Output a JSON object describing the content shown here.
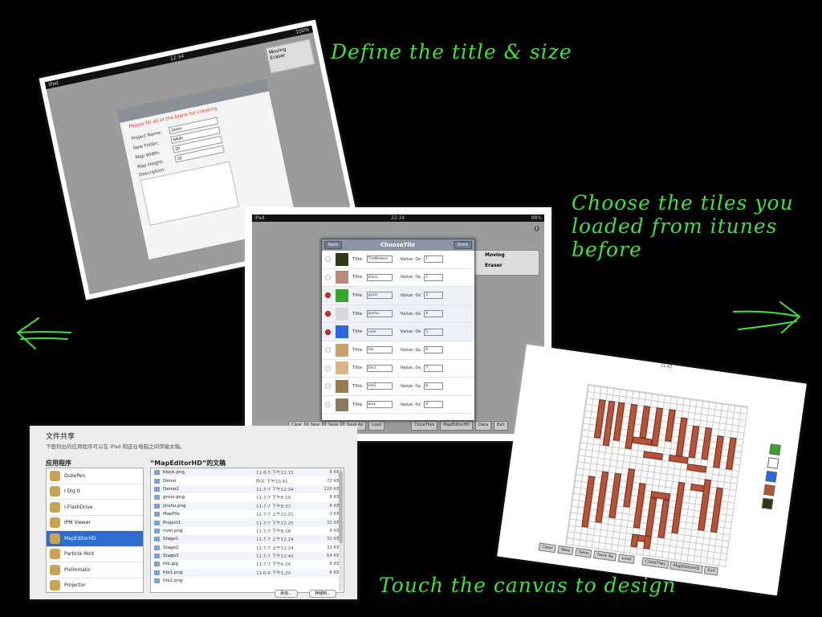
{
  "captions": {
    "define": "Define the title & size",
    "choose": "Choose the tiles you loaded from itunes before",
    "touch": "Touch the canvas to design"
  },
  "colors": {
    "accent": "#3fe13b",
    "background": "#000000"
  },
  "icons": {
    "left_arrow": "arrow-left-icon",
    "right_arrow": "arrow-right-icon"
  },
  "shot1": {
    "status_time": "12:34",
    "warning": "Please fill all of the blank for creating",
    "fields": [
      {
        "label": "Project Name:",
        "value": "Demo"
      },
      {
        "label": "New Folder:",
        "value": "Mkdir"
      },
      {
        "label": "Map Width:",
        "value": "20"
      },
      {
        "label": "Map Height:",
        "value": "32"
      }
    ],
    "description_label": "Description:",
    "side_moving": "Moving",
    "side_eraser": "Eraser"
  },
  "shot2": {
    "status_left": "iPad",
    "status_time": "22:34",
    "status_right": "98%",
    "title": "ChooseTile",
    "back_button": "Back",
    "done_button": "Done",
    "title_label": "Title:",
    "value_label": "Value: 0x",
    "tiles": [
      {
        "title": "TileModern",
        "value": "1",
        "selected": false,
        "color": "#2d3a12"
      },
      {
        "title": "block",
        "value": "2",
        "selected": false,
        "color": "#b98a7b"
      },
      {
        "title": "gross",
        "value": "3",
        "selected": true,
        "color": "#37a52a"
      },
      {
        "title": "jinshu",
        "value": "4",
        "selected": true,
        "color": "#d8d8d8"
      },
      {
        "title": "river",
        "value": "5",
        "selected": true,
        "color": "#2c66e3"
      },
      {
        "title": "tile",
        "value": "6",
        "selected": false,
        "color": "#c9a06c"
      },
      {
        "title": "tile1",
        "value": "7",
        "selected": false,
        "color": "#ddb486"
      },
      {
        "title": "tile2",
        "value": "8",
        "selected": false,
        "color": "#9c7a55"
      },
      {
        "title": "way",
        "value": "9",
        "selected": false,
        "color": "#8e7b5e"
      }
    ],
    "side_moving": "Moving",
    "side_eraser": "Eraser",
    "bottom_buttons": [
      "Clear",
      "New",
      "Save",
      "Save As",
      "Load",
      "CloseTiles",
      "MapEditorHD",
      "Data",
      "Exit"
    ]
  },
  "shot3": {
    "title": "文件共享",
    "subtitle": "下面列出的应用程序可以在 iPad 和这台电脑之间传输文稿。",
    "apps_header": "应用程序",
    "docs_header": "“MapEditorHD”的文稿",
    "apps": [
      "DukePen",
      "I Dig It",
      "i-FlashDrive",
      "IPM Viewer",
      "MapEditorHD",
      "Particle Mint",
      "Pixlromatic",
      "Projector",
      "QR HD"
    ],
    "selected_app": "MapEditorHD",
    "docs": [
      {
        "name": "block.png",
        "date": "11-6-5 下午12:15",
        "size": "8 KB"
      },
      {
        "name": "Demo",
        "date": "昨天 下午10:41",
        "size": "72 KB"
      },
      {
        "name": "Demo2",
        "date": "11-7-7 下午12:34",
        "size": "120 KB"
      },
      {
        "name": "gross.png",
        "date": "11-7-7 下午8:19",
        "size": "8 KB"
      },
      {
        "name": "jinshu.png",
        "date": "11-7-7 下午8:33",
        "size": "8 KB"
      },
      {
        "name": "MapFile",
        "date": "11-7-7 上午12:21",
        "size": "0 KB"
      },
      {
        "name": "Project1",
        "date": "11-7-7 下午12:25",
        "size": "32 KB"
      },
      {
        "name": "river.png",
        "date": "11-7-7 下午8:18",
        "size": "8 KB"
      },
      {
        "name": "Stage1",
        "date": "11-7-7 上午12:24",
        "size": "32 KB"
      },
      {
        "name": "Stage2",
        "date": "11-7-7 上午12:24",
        "size": "32 KB"
      },
      {
        "name": "Stage3",
        "date": "11-7-7 下午12:40",
        "size": "64 KB"
      },
      {
        "name": "tile.jpg",
        "date": "11-7-7 下午6:24",
        "size": "8 KB"
      },
      {
        "name": "tile1.png",
        "date": "11-6-6 下午1:23",
        "size": "8 KB"
      },
      {
        "name": "tile2.png",
        "date": "",
        "size": ""
      }
    ],
    "add_button": "添加...",
    "save_button": "存储到..."
  },
  "shot4": {
    "status_time": "21:42",
    "palette_colors": [
      "#37a52a",
      "#ffffff",
      "#2c66e3",
      "#b4543a",
      "#2d3a12"
    ],
    "bottom_buttons": [
      "Clear",
      "New",
      "Save",
      "Save As",
      "Load"
    ],
    "bottom_buttons_right": [
      "CloseTiles",
      "MapEditorHD",
      "Exit"
    ]
  }
}
